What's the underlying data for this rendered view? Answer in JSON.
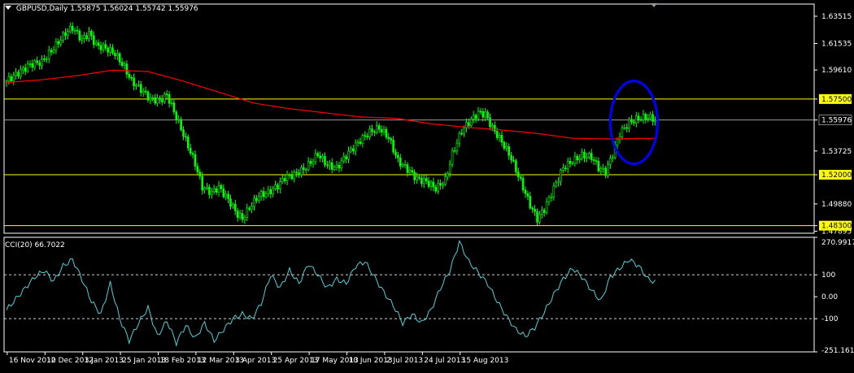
{
  "window": {
    "symbol_label": "GBPUSD,Daily",
    "ohlc_label": "1.55875 1.56024 1.55742 1.55976"
  },
  "indicator": {
    "label": "CCI(20) 66.7022",
    "axis_labels": [
      "270.9917",
      "100",
      "0.00",
      "-100",
      "-251.1611"
    ]
  },
  "colors": {
    "background": "#000000",
    "candles": "#00ff00",
    "moving_average": "#ff0000",
    "cci_line": "#4fd0d8",
    "horizontal_levels": "#ffff00",
    "annotation_ellipse": "#0000ff",
    "price_marker_bg": "#ffff00"
  },
  "chart_data": [
    {
      "type": "candlestick",
      "title": "GBPUSD,Daily",
      "ylim": [
        1.4775,
        1.644
      ],
      "y_ticks": [
        "1.63515",
        "1.61535",
        "1.59610",
        "1.57500",
        "1.55976",
        "1.53725",
        "1.52000",
        "1.49880",
        "1.48300",
        "1.47895"
      ],
      "x_tick_labels": [
        "16 Nov 2012",
        "10 Dec 2012",
        "3 Jan 2013",
        "25 Jan 2013",
        "18 Feb 2013",
        "12 Mar 2013",
        "3 Apr 2013",
        "25 Apr 2013",
        "17 May 2013",
        "10 Jun 2013",
        "2 Jul 2013",
        "24 Jul 2013",
        "15 Aug 2013"
      ],
      "close_anchors": [
        [
          0,
          1.588
        ],
        [
          5,
          1.594
        ],
        [
          10,
          1.6
        ],
        [
          15,
          1.602
        ],
        [
          20,
          1.612
        ],
        [
          25,
          1.623
        ],
        [
          28,
          1.627
        ],
        [
          32,
          1.618
        ],
        [
          35,
          1.623
        ],
        [
          38,
          1.614
        ],
        [
          42,
          1.612
        ],
        [
          46,
          1.608
        ],
        [
          50,
          1.598
        ],
        [
          53,
          1.588
        ],
        [
          57,
          1.582
        ],
        [
          61,
          1.575
        ],
        [
          65,
          1.574
        ],
        [
          68,
          1.578
        ],
        [
          72,
          1.562
        ],
        [
          76,
          1.545
        ],
        [
          80,
          1.528
        ],
        [
          83,
          1.511
        ],
        [
          87,
          1.507
        ],
        [
          90,
          1.511
        ],
        [
          94,
          1.502
        ],
        [
          98,
          1.491
        ],
        [
          100,
          1.488
        ],
        [
          103,
          1.496
        ],
        [
          107,
          1.505
        ],
        [
          111,
          1.507
        ],
        [
          115,
          1.512
        ],
        [
          118,
          1.518
        ],
        [
          122,
          1.52
        ],
        [
          126,
          1.524
        ],
        [
          129,
          1.529
        ],
        [
          132,
          1.535
        ],
        [
          136,
          1.527
        ],
        [
          140,
          1.525
        ],
        [
          145,
          1.536
        ],
        [
          150,
          1.545
        ],
        [
          154,
          1.551
        ],
        [
          158,
          1.554
        ],
        [
          162,
          1.547
        ],
        [
          166,
          1.53
        ],
        [
          170,
          1.524
        ],
        [
          174,
          1.517
        ],
        [
          178,
          1.515
        ],
        [
          182,
          1.51
        ],
        [
          186,
          1.516
        ],
        [
          189,
          1.535
        ],
        [
          193,
          1.552
        ],
        [
          196,
          1.558
        ],
        [
          200,
          1.565
        ],
        [
          203,
          1.564
        ],
        [
          206,
          1.554
        ],
        [
          210,
          1.544
        ],
        [
          214,
          1.532
        ],
        [
          218,
          1.515
        ],
        [
          222,
          1.498
        ],
        [
          225,
          1.488
        ],
        [
          228,
          1.495
        ],
        [
          232,
          1.51
        ],
        [
          236,
          1.525
        ],
        [
          240,
          1.53
        ],
        [
          244,
          1.534
        ],
        [
          248,
          1.533
        ],
        [
          251,
          1.525
        ],
        [
          254,
          1.522
        ],
        [
          257,
          1.535
        ],
        [
          260,
          1.55
        ],
        [
          264,
          1.558
        ],
        [
          268,
          1.561
        ],
        [
          272,
          1.562
        ],
        [
          275,
          1.5598
        ]
      ],
      "moving_average_anchors": [
        [
          0,
          1.587
        ],
        [
          15,
          1.589
        ],
        [
          30,
          1.592
        ],
        [
          45,
          1.596
        ],
        [
          60,
          1.595
        ],
        [
          75,
          1.588
        ],
        [
          90,
          1.58
        ],
        [
          105,
          1.572
        ],
        [
          120,
          1.568
        ],
        [
          135,
          1.565
        ],
        [
          150,
          1.562
        ],
        [
          165,
          1.561
        ],
        [
          180,
          1.557
        ],
        [
          195,
          1.5545
        ],
        [
          210,
          1.5525
        ],
        [
          225,
          1.55
        ],
        [
          240,
          1.5465
        ],
        [
          255,
          1.546
        ],
        [
          275,
          1.5465
        ]
      ],
      "horizontal_levels": [
        {
          "label": "1.57500",
          "value": 1.575
        },
        {
          "label": "1.52000",
          "value": 1.52
        },
        {
          "label": "1.48300",
          "value": 1.483
        }
      ],
      "current_price": {
        "label": "1.55976",
        "value": 1.55976
      },
      "annotation": {
        "shape": "ellipse",
        "center_value": 1.558,
        "center_index": 266
      }
    },
    {
      "type": "line",
      "title": "CCI(20) 66.7022",
      "ylim": [
        -251.1611,
        270.9917
      ],
      "levels": [
        100,
        -100
      ],
      "values": [
        [
          0,
          -60
        ],
        [
          4,
          -10
        ],
        [
          8,
          40
        ],
        [
          12,
          90
        ],
        [
          16,
          120
        ],
        [
          20,
          70
        ],
        [
          24,
          140
        ],
        [
          28,
          170
        ],
        [
          32,
          80
        ],
        [
          36,
          -20
        ],
        [
          40,
          -80
        ],
        [
          44,
          60
        ],
        [
          48,
          -100
        ],
        [
          52,
          -200
        ],
        [
          56,
          -120
        ],
        [
          60,
          -50
        ],
        [
          64,
          -180
        ],
        [
          68,
          -110
        ],
        [
          72,
          -210
        ],
        [
          76,
          -130
        ],
        [
          80,
          -190
        ],
        [
          84,
          -120
        ],
        [
          88,
          -200
        ],
        [
          92,
          -150
        ],
        [
          96,
          -100
        ],
        [
          100,
          -80
        ],
        [
          104,
          -100
        ],
        [
          108,
          -30
        ],
        [
          112,
          100
        ],
        [
          116,
          40
        ],
        [
          120,
          120
        ],
        [
          124,
          60
        ],
        [
          128,
          150
        ],
        [
          132,
          100
        ],
        [
          136,
          40
        ],
        [
          140,
          80
        ],
        [
          144,
          60
        ],
        [
          148,
          140
        ],
        [
          152,
          160
        ],
        [
          156,
          90
        ],
        [
          160,
          20
        ],
        [
          164,
          -40
        ],
        [
          168,
          -120
        ],
        [
          172,
          -80
        ],
        [
          176,
          -120
        ],
        [
          180,
          -60
        ],
        [
          184,
          40
        ],
        [
          188,
          120
        ],
        [
          192,
          250
        ],
        [
          196,
          160
        ],
        [
          200,
          110
        ],
        [
          204,
          60
        ],
        [
          208,
          -20
        ],
        [
          212,
          -90
        ],
        [
          216,
          -150
        ],
        [
          220,
          -180
        ],
        [
          224,
          -140
        ],
        [
          228,
          -70
        ],
        [
          232,
          10
        ],
        [
          236,
          80
        ],
        [
          240,
          130
        ],
        [
          244,
          90
        ],
        [
          248,
          30
        ],
        [
          252,
          -20
        ],
        [
          256,
          90
        ],
        [
          260,
          130
        ],
        [
          264,
          170
        ],
        [
          268,
          140
        ],
        [
          272,
          80
        ],
        [
          275,
          66.7
        ]
      ]
    }
  ]
}
